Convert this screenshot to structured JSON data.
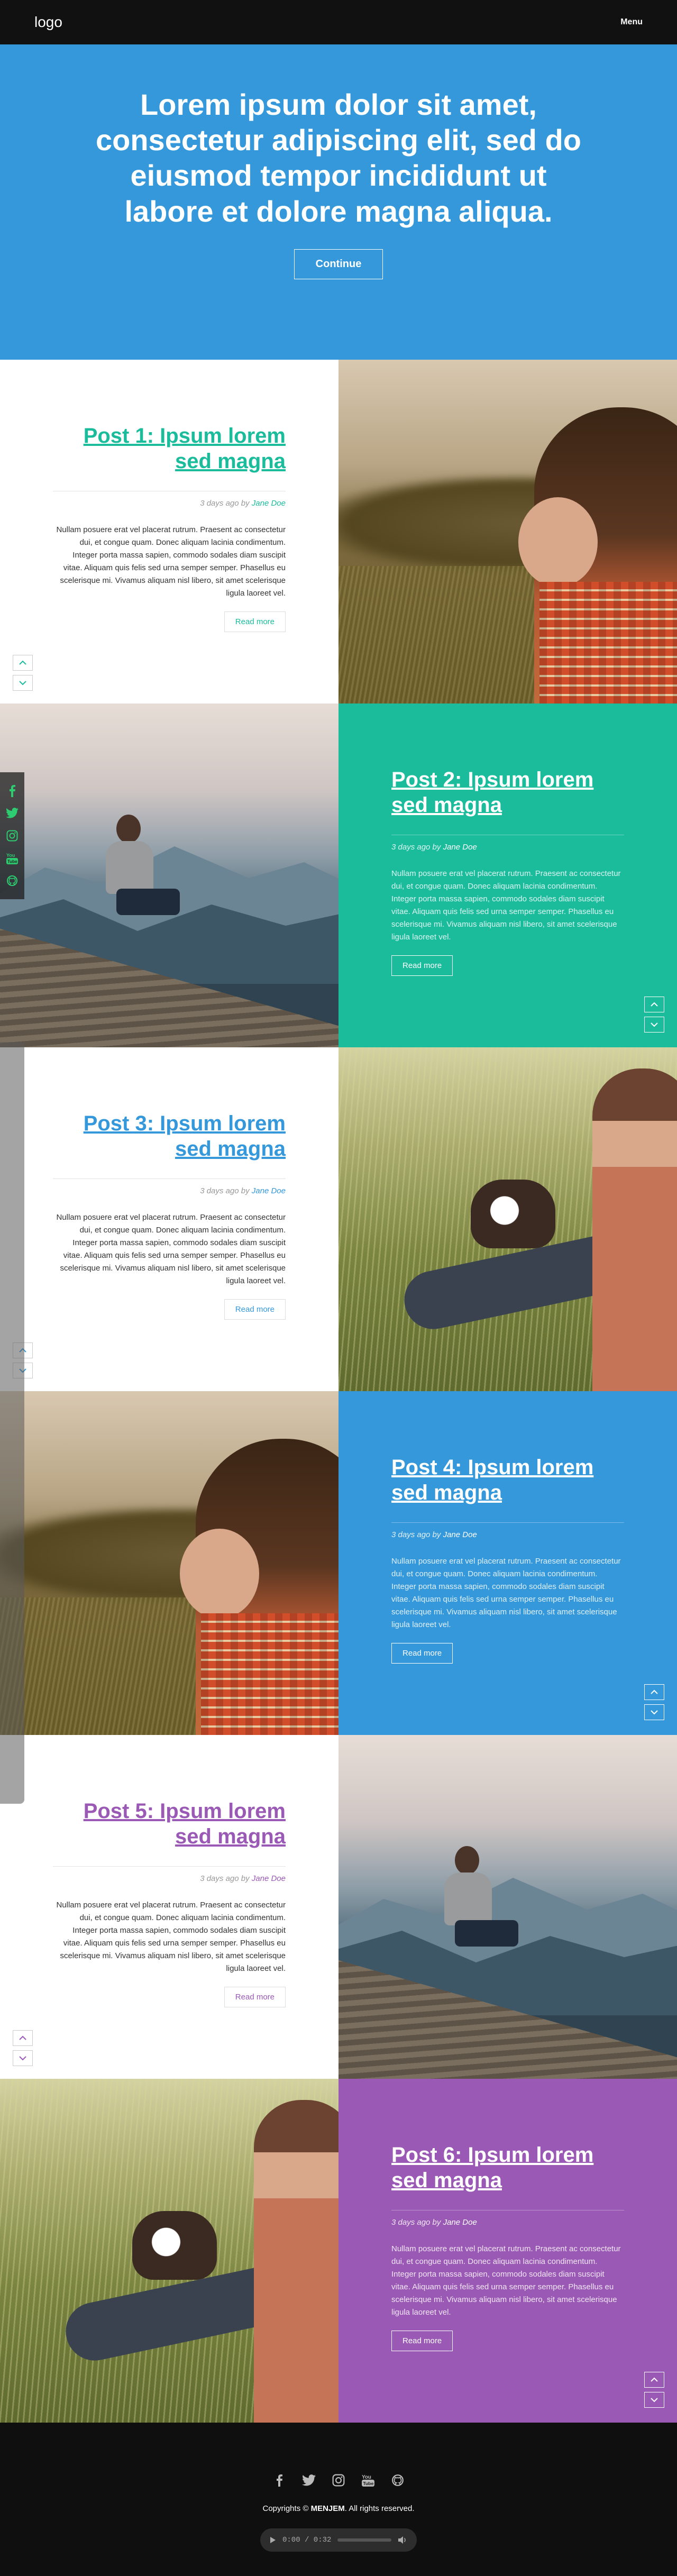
{
  "header": {
    "logo": "logo",
    "menu": "Menu"
  },
  "hero": {
    "headline": "Lorem ipsum dolor sit amet, consectetur adipiscing elit, sed do eiusmod tempor incididunt ut labore et dolore magna aliqua.",
    "button": "Continue",
    "background": "#3498db"
  },
  "colors": {
    "green": "#1abc9c",
    "blue": "#3498db",
    "purple": "#9b59b6",
    "footer": "#0f0f0f"
  },
  "posts": [
    {
      "title": "Post 1: Ipsum lorem sed magna",
      "meta_prefix": "3 days ago by",
      "author": "Jane Doe",
      "excerpt": "Nullam posuere erat vel placerat rutrum. Praesent ac consectetur dui, et congue quam. Donec aliquam lacinia condimentum. Integer porta massa sapien, commodo sodales diam suscipit vitae. Aliquam quis felis sed urna semper semper. Phasellus eu scelerisque mi. Vivamus aliquam nisl libero, sit amet scelerisque ligula laoreet vel.",
      "read_more": "Read more",
      "accent": "#1abc9c"
    },
    {
      "title": "Post 2: Ipsum lorem sed magna",
      "meta_prefix": "3 days ago by",
      "author": "Jane Doe",
      "excerpt": "Nullam posuere erat vel placerat rutrum. Praesent ac consectetur dui, et congue quam. Donec aliquam lacinia condimentum. Integer porta massa sapien, commodo sodales diam suscipit vitae. Aliquam quis felis sed urna semper semper. Phasellus eu scelerisque mi. Vivamus aliquam nisl libero, sit amet scelerisque ligula laoreet vel.",
      "read_more": "Read more",
      "accent": "#1abc9c"
    },
    {
      "title": "Post 3: Ipsum lorem sed magna",
      "meta_prefix": "3 days ago by",
      "author": "Jane Doe",
      "excerpt": "Nullam posuere erat vel placerat rutrum. Praesent ac consectetur dui, et congue quam. Donec aliquam lacinia condimentum. Integer porta massa sapien, commodo sodales diam suscipit vitae. Aliquam quis felis sed urna semper semper. Phasellus eu scelerisque mi. Vivamus aliquam nisl libero, sit amet scelerisque ligula laoreet vel.",
      "read_more": "Read more",
      "accent": "#3498db"
    },
    {
      "title": "Post 4: Ipsum lorem sed magna",
      "meta_prefix": "3 days ago by",
      "author": "Jane Doe",
      "excerpt": "Nullam posuere erat vel placerat rutrum. Praesent ac consectetur dui, et congue quam. Donec aliquam lacinia condimentum. Integer porta massa sapien, commodo sodales diam suscipit vitae. Aliquam quis felis sed urna semper semper. Phasellus eu scelerisque mi. Vivamus aliquam nisl libero, sit amet scelerisque ligula laoreet vel.",
      "read_more": "Read more",
      "accent": "#3498db"
    },
    {
      "title": "Post 5: Ipsum lorem sed magna",
      "meta_prefix": "3 days ago by",
      "author": "Jane Doe",
      "excerpt": "Nullam posuere erat vel placerat rutrum. Praesent ac consectetur dui, et congue quam. Donec aliquam lacinia condimentum. Integer porta massa sapien, commodo sodales diam suscipit vitae. Aliquam quis felis sed urna semper semper. Phasellus eu scelerisque mi. Vivamus aliquam nisl libero, sit amet scelerisque ligula laoreet vel.",
      "read_more": "Read more",
      "accent": "#9b59b6"
    },
    {
      "title": "Post 6: Ipsum lorem sed magna",
      "meta_prefix": "3 days ago by",
      "author": "Jane Doe",
      "excerpt": "Nullam posuere erat vel placerat rutrum. Praesent ac consectetur dui, et congue quam. Donec aliquam lacinia condimentum. Integer porta massa sapien, commodo sodales diam suscipit vitae. Aliquam quis felis sed urna semper semper. Phasellus eu scelerisque mi. Vivamus aliquam nisl libero, sit amet scelerisque ligula laoreet vel.",
      "read_more": "Read more",
      "accent": "#9b59b6"
    }
  ],
  "social_icons": [
    "facebook-icon",
    "twitter-icon",
    "instagram-icon",
    "youtube-icon",
    "github-icon"
  ],
  "footer": {
    "copyright_prefix": "Copyrights ©",
    "brand": "MENJEM",
    "copyright_suffix": ". All rights reserved."
  },
  "player": {
    "time": "0:00 / 0:32",
    "progress": 0.0
  }
}
